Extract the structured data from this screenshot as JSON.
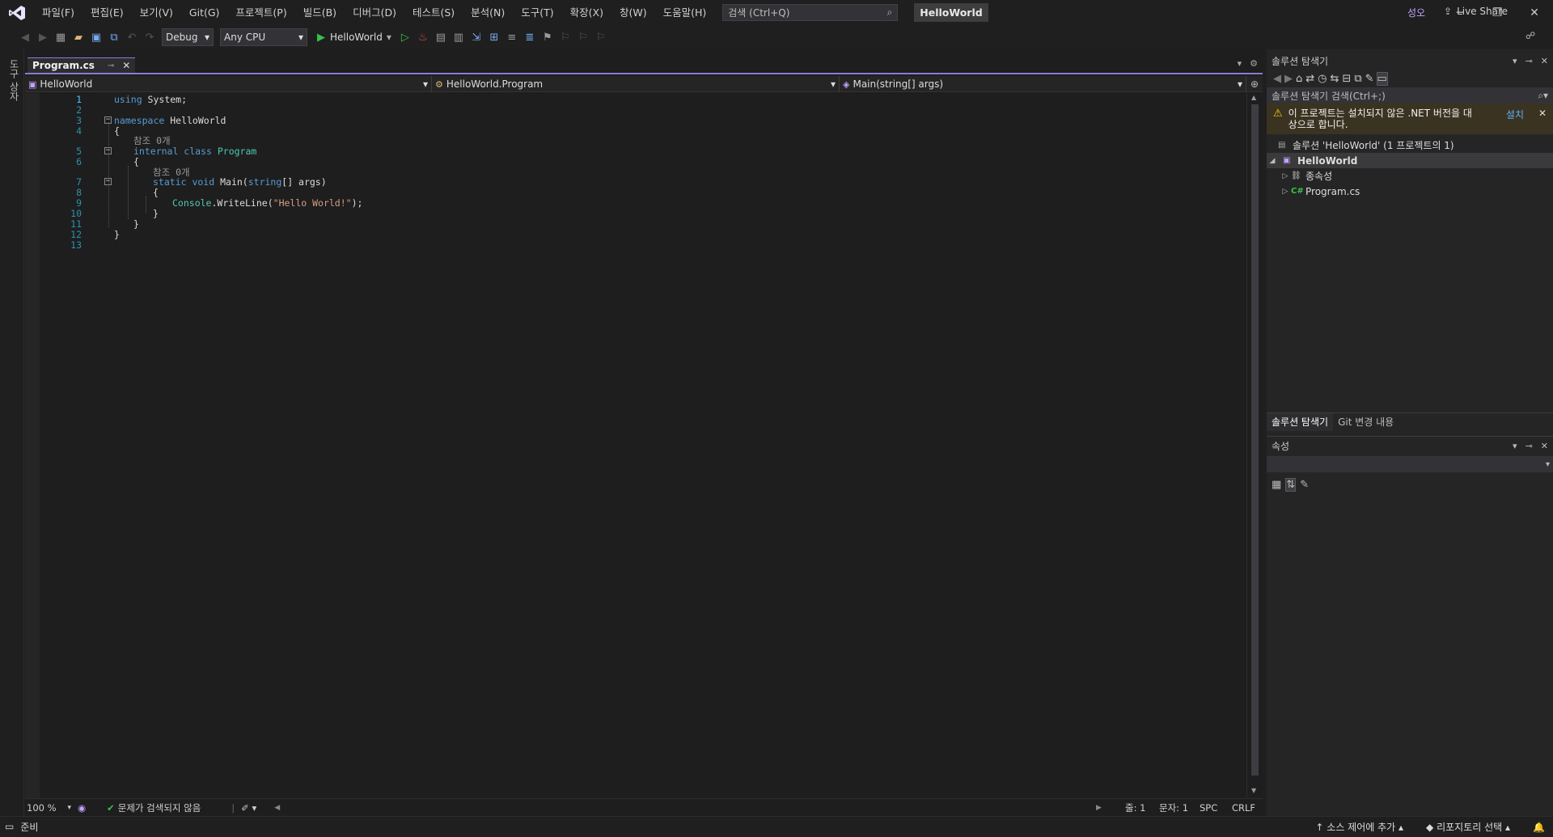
{
  "menu": {
    "items": [
      "파일(F)",
      "편집(E)",
      "보기(V)",
      "Git(G)",
      "프로젝트(P)",
      "빌드(B)",
      "디버그(D)",
      "테스트(S)",
      "분석(N)",
      "도구(T)",
      "확장(X)",
      "창(W)",
      "도움말(H)"
    ],
    "search_placeholder": "검색 (Ctrl+Q)",
    "solution_title": "HelloWorld",
    "user_initials": "성오"
  },
  "toolbar": {
    "configuration": "Debug",
    "platform": "Any CPU",
    "run_target": "HelloWorld",
    "live_share": "Live Share"
  },
  "left_strip": {
    "label": "도구 상자"
  },
  "editor": {
    "tab": {
      "label": "Program.cs"
    },
    "nav": {
      "project": "HelloWorld",
      "type": "HelloWorld.Program",
      "member": "Main(string[] args)"
    },
    "lines": [
      {
        "num": "1"
      },
      {
        "num": "2"
      },
      {
        "num": "3"
      },
      {
        "num": "4"
      },
      {
        "num": "5"
      },
      {
        "num": "6"
      },
      {
        "num": "7"
      },
      {
        "num": "8"
      },
      {
        "num": "9"
      },
      {
        "num": "10"
      },
      {
        "num": "11"
      },
      {
        "num": "12"
      },
      {
        "num": "13"
      }
    ],
    "code": {
      "using": "using",
      "system": " System;",
      "namespace_kw": "namespace",
      "namespace_name": " HelloWorld",
      "brace_open": "{",
      "brace_close": "}",
      "refs_class": "참조 0개",
      "internal_kw": "internal class",
      "class_name": " Program",
      "refs_main": "참조 0개",
      "static_void": "static void",
      "main_sig_a": " Main(",
      "string_kw": "string",
      "main_sig_b": "[] args)",
      "console": "Console",
      "writeline": ".WriteLine(",
      "hello": "\"Hello World!\"",
      "stmt_end": ");"
    },
    "status": {
      "zoom": "100 %",
      "issues": "문제가 검색되지 않음",
      "line": "줄: 1",
      "col": "문자: 1",
      "spacing": "SPC",
      "eol": "CRLF"
    }
  },
  "solution_explorer": {
    "title": "솔루션 탐색기",
    "search_placeholder": "솔루션 탐색기 검색(Ctrl+;)",
    "warning_text": "이 프로젝트는 설치되지 않은 .NET 버전을 대상으로 합니다.",
    "warning_action": "설치",
    "solution_label": "솔루션 'HelloWorld' (1 프로젝트의 1)",
    "project_label": "HelloWorld",
    "dependencies_label": "종속성",
    "file_label": "Program.cs"
  },
  "panel_tabs": [
    "솔루션 탐색기",
    "Git 변경 내용"
  ],
  "properties": {
    "title": "속성"
  },
  "statusbar": {
    "ready": "준비",
    "source_control": "소스 제어에 추가",
    "repository": "리포지토리 선택"
  },
  "colors": {
    "accent": "#8f79d6",
    "keyword": "#569cd6",
    "type": "#4ec9b0",
    "string": "#d69d85",
    "line_number": "#2b91af"
  }
}
